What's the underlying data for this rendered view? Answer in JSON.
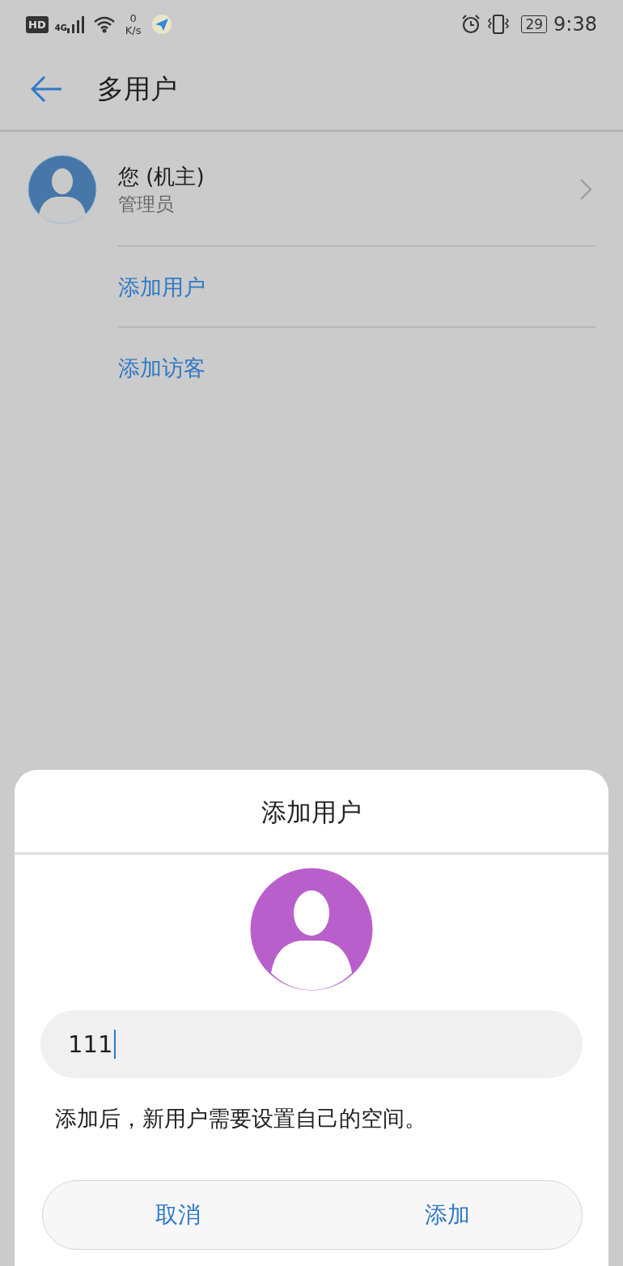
{
  "status_bar": {
    "hd": "HD",
    "network": "4G",
    "speed_value": "0",
    "speed_unit": "K/s",
    "battery": "29",
    "time": "9:38"
  },
  "header": {
    "title": "多用户"
  },
  "owner": {
    "name": "您 (机主)",
    "role": "管理员"
  },
  "actions": [
    {
      "label": "添加用户"
    },
    {
      "label": "添加访客"
    }
  ],
  "dialog": {
    "title": "添加用户",
    "name_field": {
      "value": "111"
    },
    "note": "添加后，新用户需要设置自己的空间。",
    "buttons": [
      {
        "label": "取消"
      },
      {
        "label": "添加"
      }
    ]
  }
}
